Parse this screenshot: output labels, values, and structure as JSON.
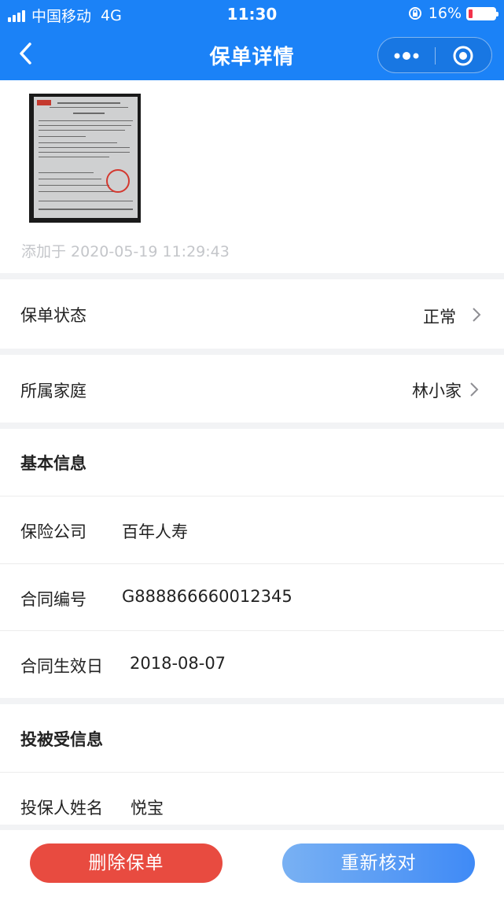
{
  "status_bar": {
    "carrier": "中国移动",
    "network": "4G",
    "time": "11:30",
    "battery": "16%",
    "battery_level": 0.16
  },
  "nav": {
    "title": "保单详情",
    "back_icon": "chevron-left-icon",
    "more_icon": "more-dots-icon",
    "close_icon": "target-circle-icon"
  },
  "document": {
    "added_time": "添加于 2020-05-19 11:29:43"
  },
  "policy_status": {
    "label": "保单状态",
    "value": "正常"
  },
  "family": {
    "label": "所属家庭",
    "value": "林小家"
  },
  "basic_info": {
    "title": "基本信息",
    "rows": [
      {
        "label": "保险公司",
        "value": "百年人寿"
      },
      {
        "label": "合同编号",
        "value": "G888866660012345"
      },
      {
        "label": "合同生效日",
        "value": "2018-08-07"
      }
    ]
  },
  "insured_info": {
    "title": "投被受信息",
    "rows": [
      {
        "label": "投保人姓名",
        "value": "悦宝"
      }
    ]
  },
  "actions": {
    "delete_label": "删除保单",
    "recheck_label": "重新核对"
  },
  "colors": {
    "header": "#1b82f7",
    "delete": "#e84b40",
    "recheck_start": "#79b1f3",
    "recheck_end": "#3f8af6",
    "muted_text": "#c4c6ca"
  }
}
